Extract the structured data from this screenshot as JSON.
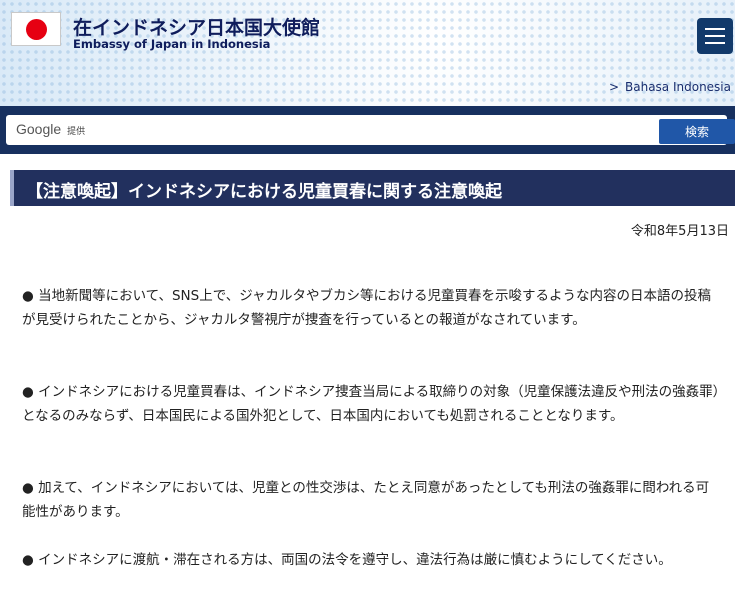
{
  "header": {
    "title_ja": "在インドネシア日本国大使館",
    "title_en": "Embassy of Japan in Indonesia",
    "lang_arrow": ">",
    "lang_link": "Bahasa Indonesia"
  },
  "search": {
    "google_label": "Google",
    "google_sub": "提供",
    "query": "",
    "button_label": "検索"
  },
  "article": {
    "title": "【注意喚起】インドネシアにおける児童買春に関する注意喚起",
    "date": "令和8年5月13日",
    "paragraphs": [
      "● 当地新聞等において、SNS上で、ジャカルタやブカシ等における児童買春を示唆するような内容の日本語の投稿が見受けられたことから、ジャカルタ警視庁が捜査を行っているとの報道がなされています。",
      "● インドネシアにおける児童買春は、インドネシア捜査当局による取締りの対象（児童保護法違反や刑法の強姦罪）となるのみならず、日本国民による国外犯として、日本国内においても処罰されることとなります。",
      "● 加えて、インドネシアにおいては、児童との性交渉は、たとえ同意があったとしても刑法の強姦罪に問われる可能性があります。",
      "● インドネシアに渡航・滞在される方は、両国の法令を遵守し、違法行為は厳に慎むようにしてください。"
    ]
  },
  "colors": {
    "navy": "#17305f",
    "title_bar": "#22305e",
    "button": "#2057a8",
    "flag_red": "#e60012"
  },
  "icons": {
    "flag": "japan-flag-icon",
    "menu": "hamburger-menu-icon"
  }
}
